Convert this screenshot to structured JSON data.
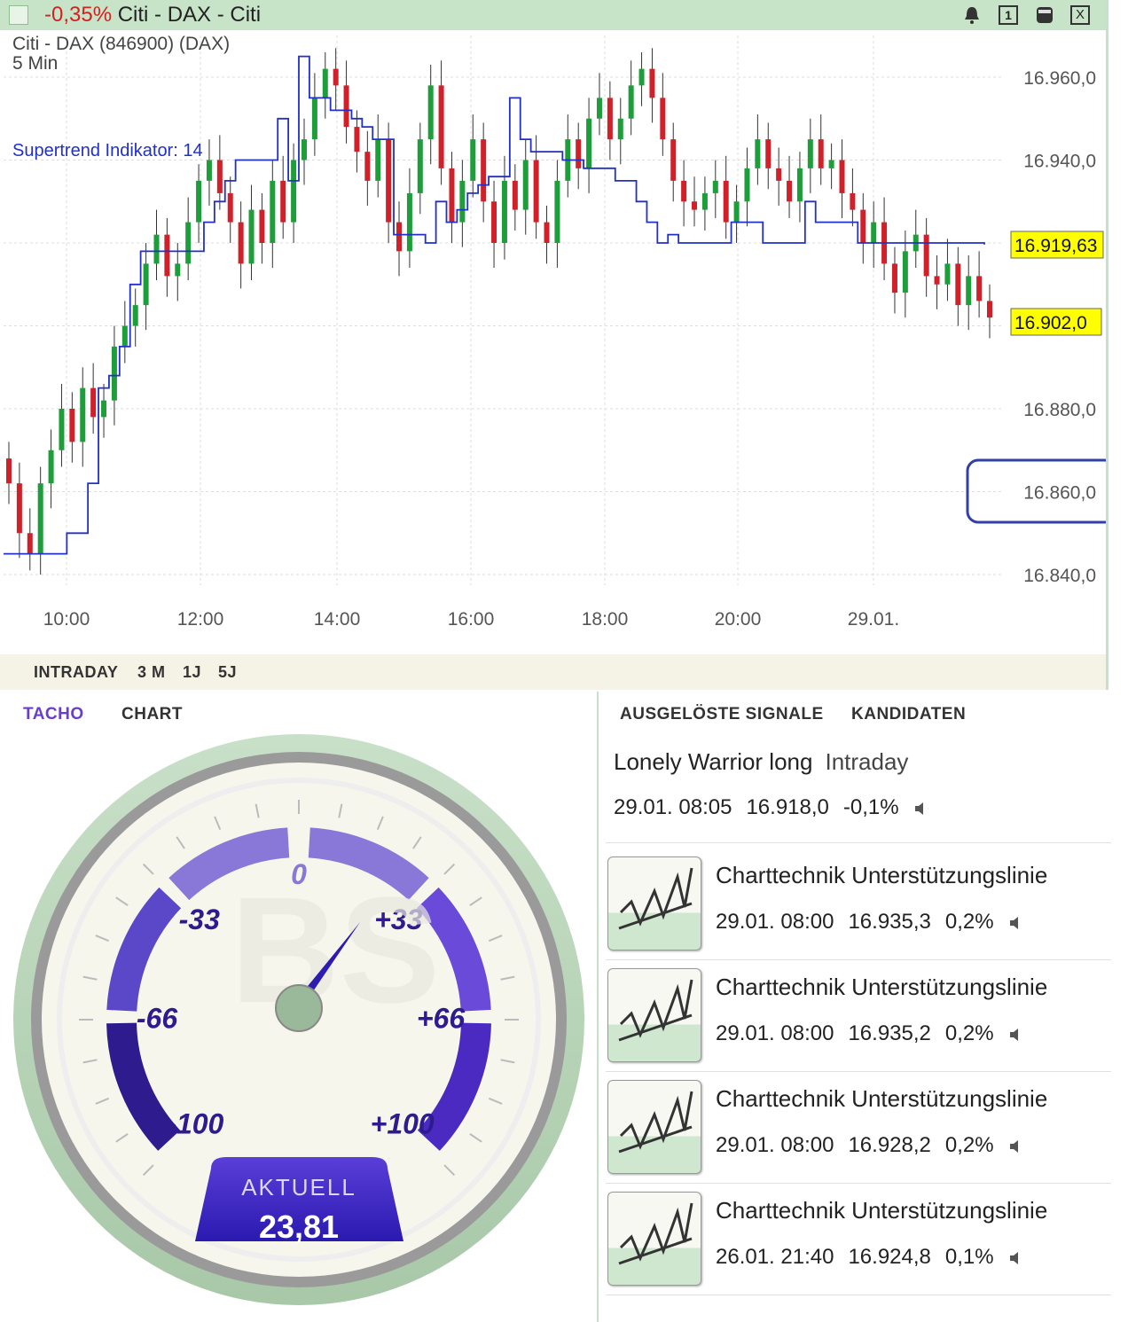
{
  "window": {
    "title_change": "-0,35%",
    "title_name": "Citi - DAX - Citi",
    "buttons": {
      "one_label": "1",
      "close_label": "X"
    }
  },
  "chart": {
    "instrument": "Citi - DAX (846900) (DAX)",
    "interval": "5 Min",
    "indicator_label": "Supertrend Indikator: 14",
    "current_supertrend_label": "16.919,63",
    "current_price_label": "16.902,0",
    "highlighted_tick": "16.860,0",
    "colors": {
      "up": "#1e9e3a",
      "down": "#d0202a",
      "supertrend": "#2030c8",
      "marker": "#ffff00",
      "highlight": "#3040a8"
    }
  },
  "chart_data": {
    "type": "candlestick",
    "y_ticks": [
      "16.960,0",
      "16.940,0",
      "16.920,0",
      "16.900,0",
      "16.880,0",
      "16.860,0",
      "16.840,0"
    ],
    "x_ticks": [
      "10:00",
      "12:00",
      "14:00",
      "16:00",
      "18:00",
      "20:00",
      "29.01."
    ],
    "ylim": [
      16836,
      16970
    ],
    "last_close": 16902.0,
    "supertrend_last": 16919.63,
    "closes": [
      16862,
      16850,
      16845,
      16862,
      16870,
      16880,
      16872,
      16885,
      16878,
      16882,
      16895,
      16900,
      16905,
      16915,
      16922,
      16912,
      16915,
      16925,
      16935,
      16940,
      16932,
      16925,
      16915,
      16928,
      16920,
      16935,
      16925,
      16940,
      16945,
      16955,
      16962,
      16958,
      16948,
      16942,
      16935,
      16945,
      16925,
      16918,
      16932,
      16945,
      16958,
      16938,
      16925,
      16935,
      16945,
      16930,
      16920,
      16935,
      16928,
      16940,
      16925,
      16920,
      16935,
      16945,
      16938,
      16950,
      16955,
      16945,
      16950,
      16958,
      16962,
      16955,
      16945,
      16935,
      16930,
      16928,
      16932,
      16935,
      16925,
      16930,
      16938,
      16945,
      16938,
      16935,
      16930,
      16938,
      16945,
      16938,
      16940,
      16932,
      16928,
      16920,
      16925,
      16915,
      16908,
      16918,
      16922,
      16912,
      16910,
      16915,
      16905,
      16912,
      16906,
      16902
    ],
    "supertrend": [
      16845,
      16845,
      16845,
      16845,
      16845,
      16845,
      16850,
      16850,
      16862,
      16885,
      16888,
      16895,
      16910,
      16918,
      16918,
      16918,
      16918,
      16918,
      16918,
      16925,
      16930,
      16935,
      16940,
      16940,
      16940,
      16940,
      16950,
      16935,
      16965,
      16955,
      16955,
      16952,
      16952,
      16950,
      16948,
      16945,
      16945,
      16922,
      16922,
      16922,
      16920,
      16930,
      16925,
      16928,
      16932,
      16934,
      16936,
      16936,
      16955,
      16945,
      16942,
      16942,
      16942,
      16940,
      16940,
      16938,
      16938,
      16938,
      16935,
      16935,
      16930,
      16925,
      16920,
      16922,
      16920,
      16920,
      16920,
      16920,
      16920,
      16925,
      16925,
      16925,
      16920,
      16920,
      16920,
      16920,
      16930,
      16925,
      16925,
      16925,
      16925,
      16920,
      16920,
      16920,
      16920,
      16920,
      16920,
      16920,
      16920,
      16920,
      16920,
      16920,
      16920,
      16919.63
    ]
  },
  "range_tabs": [
    "INTRADAY",
    "3 M",
    "1J",
    "5J"
  ],
  "tacho": {
    "tabs": [
      "TACHO",
      "CHART"
    ],
    "scale_labels": [
      "-100",
      "-66",
      "-33",
      "0",
      "+33",
      "+66",
      "+100"
    ],
    "current_label": "AKTUELL",
    "current_value": "23,81",
    "value": 23.81
  },
  "signals": {
    "tabs": [
      "AUSGELÖSTE SIGNALE",
      "KANDIDATEN"
    ],
    "first": {
      "strategy": "Lonely Warrior long",
      "timeframe": "Intraday",
      "date": "29.01. 08:05",
      "price": "16.918,0",
      "change": "-0,1%"
    },
    "items": [
      {
        "name": "Charttechnik Unterstützungslinie",
        "date": "29.01. 08:00",
        "price": "16.935,3",
        "change": "0,2%"
      },
      {
        "name": "Charttechnik Unterstützungslinie",
        "date": "29.01. 08:00",
        "price": "16.935,2",
        "change": "0,2%"
      },
      {
        "name": "Charttechnik Unterstützungslinie",
        "date": "29.01. 08:00",
        "price": "16.928,2",
        "change": "0,2%"
      },
      {
        "name": "Charttechnik Unterstützungslinie",
        "date": "26.01. 21:40",
        "price": "16.924,8",
        "change": "0,1%"
      }
    ]
  }
}
